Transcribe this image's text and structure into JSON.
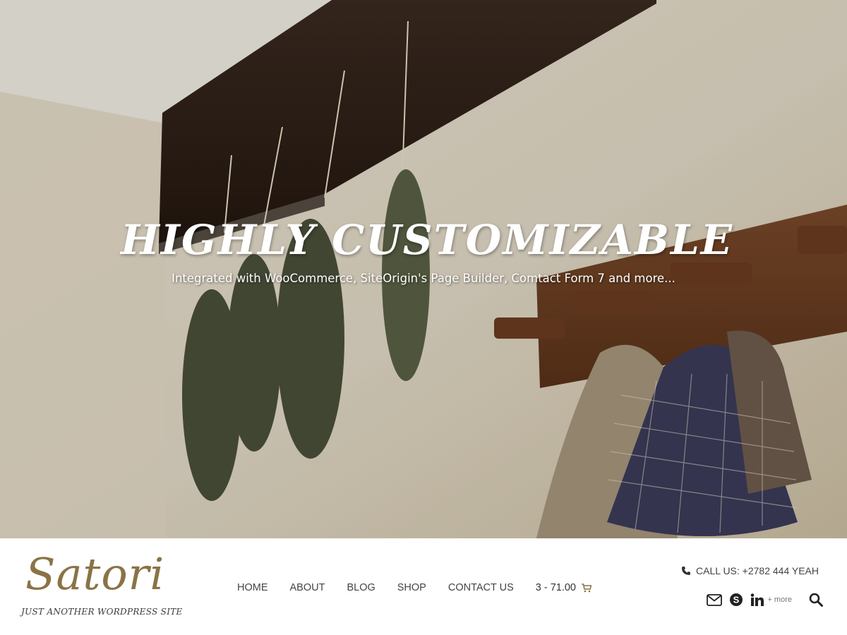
{
  "hero": {
    "title": "HIGHLY CUSTOMIZABLE",
    "subtitle": "Integrated with WooCommerce, SiteOrigin's Page Builder, Comtact Form 7 and more..."
  },
  "site": {
    "logo": "Satori",
    "tagline": "JUST ANOTHER WORDPRESS SITE"
  },
  "nav": {
    "items": [
      {
        "label": "HOME"
      },
      {
        "label": "ABOUT"
      },
      {
        "label": "BLOG"
      },
      {
        "label": "SHOP"
      },
      {
        "label": "CONTACT US"
      }
    ],
    "cart_label": "3 - 71.00",
    "cart_icon": "shopping-cart-icon"
  },
  "contact": {
    "phone_text": "CALL US: +2782 444 YEAH",
    "phone_icon": "phone-icon"
  },
  "social": {
    "icons": [
      "envelope-icon",
      "skype-icon",
      "linkedin-icon"
    ],
    "more_label": "+ more",
    "search_icon": "search-icon"
  },
  "colors": {
    "brand": "#8a7345",
    "nav_text": "#444444",
    "hero_text": "#ffffff"
  }
}
